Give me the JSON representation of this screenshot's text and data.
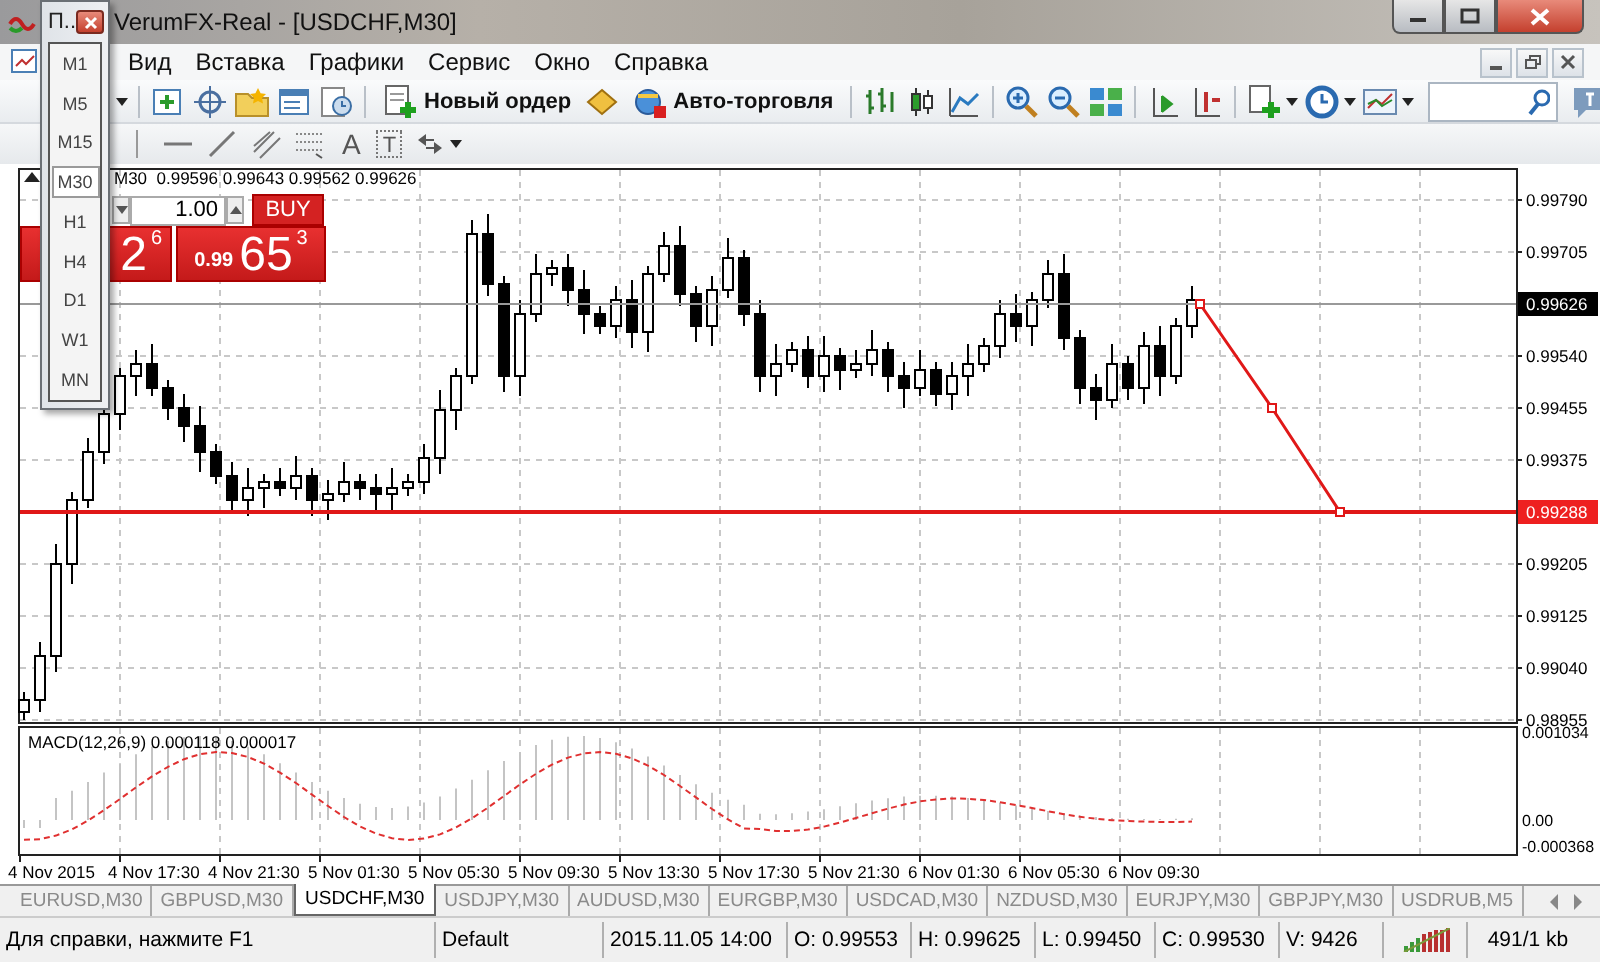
{
  "window": {
    "title": "VerumFX-Real - [USDCHF,M30]"
  },
  "menu": [
    "Вид",
    "Вставка",
    "Графики",
    "Сервис",
    "Окно",
    "Справка"
  ],
  "toolbar": {
    "buttons": [
      {
        "label": "Новый ордер"
      },
      {
        "label": "Авто-торговля"
      }
    ]
  },
  "drawing_tools": {
    "text_tool": "A",
    "label_tool": "T"
  },
  "chart": {
    "header": "M30  0.99596 0.99643 0.99562 0.99626",
    "one_click": {
      "lot": "1.00",
      "buy_label": "BUY",
      "sell_price": {
        "big": "2",
        "sup": "6"
      },
      "buy_price": {
        "small": "0.99",
        "big": "65",
        "sup": "3"
      }
    },
    "price_axis": [
      {
        "label": "0.99790",
        "kind": "tick"
      },
      {
        "label": "0.99705",
        "kind": "tick"
      },
      {
        "label": "0.99626",
        "kind": "bid"
      },
      {
        "label": "0.99540",
        "kind": "tick"
      },
      {
        "label": "0.99455",
        "kind": "tick"
      },
      {
        "label": "0.99375",
        "kind": "tick"
      },
      {
        "label": "0.99288",
        "kind": "line"
      },
      {
        "label": "0.99205",
        "kind": "tick"
      },
      {
        "label": "0.99125",
        "kind": "tick"
      },
      {
        "label": "0.99040",
        "kind": "tick"
      },
      {
        "label": "0.98955",
        "kind": "tick"
      }
    ],
    "indicator": {
      "label": "MACD(12,26,9) 0.000118 0.000017",
      "axis": [
        "0.001034",
        "0.00",
        "-0.000368"
      ]
    },
    "time_axis": [
      "4 Nov 2015",
      "4 Nov 17:30",
      "4 Nov 21:30",
      "5 Nov 01:30",
      "5 Nov 05:30",
      "5 Nov 09:30",
      "5 Nov 13:30",
      "5 Nov 17:30",
      "5 Nov 21:30",
      "6 Nov 01:30",
      "6 Nov 05:30",
      "6 Nov 09:30"
    ]
  },
  "tabs": [
    {
      "label": "EURUSD,M30",
      "selected": false
    },
    {
      "label": "GBPUSD,M30",
      "selected": false
    },
    {
      "label": "USDCHF,M30",
      "selected": true
    },
    {
      "label": "USDJPY,M30",
      "selected": false
    },
    {
      "label": "AUDUSD,M30",
      "selected": false
    },
    {
      "label": "EURGBP,M30",
      "selected": false
    },
    {
      "label": "USDCAD,M30",
      "selected": false
    },
    {
      "label": "NZDUSD,M30",
      "selected": false
    },
    {
      "label": "EURJPY,M30",
      "selected": false
    },
    {
      "label": "GBPJPY,M30",
      "selected": false
    },
    {
      "label": "USDRUB,M5",
      "selected": false
    }
  ],
  "status_bar": {
    "help": "Для справки, нажмите F1",
    "profile": "Default",
    "time": "2015.11.05 14:00",
    "open": "O: 0.99553",
    "high": "H: 0.99625",
    "low": "L: 0.99450",
    "close": "C: 0.99530",
    "volume": "V: 9426",
    "traffic": "491/1 kb"
  },
  "timeframe_menu": {
    "title": "П..",
    "items": [
      {
        "label": "M1",
        "selected": false
      },
      {
        "label": "M5",
        "selected": false
      },
      {
        "label": "M15",
        "selected": false
      },
      {
        "label": "M30",
        "selected": true
      },
      {
        "label": "H1",
        "selected": false
      },
      {
        "label": "H4",
        "selected": false
      },
      {
        "label": "D1",
        "selected": false
      },
      {
        "label": "W1",
        "selected": false
      },
      {
        "label": "MN",
        "selected": false
      }
    ]
  }
}
